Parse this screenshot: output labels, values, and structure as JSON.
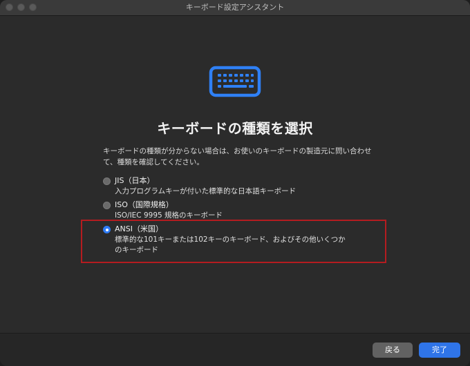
{
  "window": {
    "title": "キーボード設定アシスタント"
  },
  "icon": {
    "name": "keyboard-icon",
    "color": "#2f80f5"
  },
  "heading": "キーボードの種類を選択",
  "description": "キーボードの種類が分からない場合は、お使いのキーボードの製造元に問い合わせて、種類を確認してください。",
  "options": [
    {
      "title": "JIS（日本）",
      "description": "入力プログラムキーが付いた標準的な日本語キーボード",
      "selected": false
    },
    {
      "title": "ISO（国際規格）",
      "description": "ISO/IEC 9995 規格のキーボード",
      "selected": false
    },
    {
      "title": "ANSI（米国）",
      "description": "標準的な101キーまたは102キーのキーボード、およびその他いくつかのキーボード",
      "selected": true
    }
  ],
  "buttons": {
    "back": "戻る",
    "continue": "完了"
  },
  "colors": {
    "accent": "#2f74e8",
    "highlight": "#b51c20"
  }
}
